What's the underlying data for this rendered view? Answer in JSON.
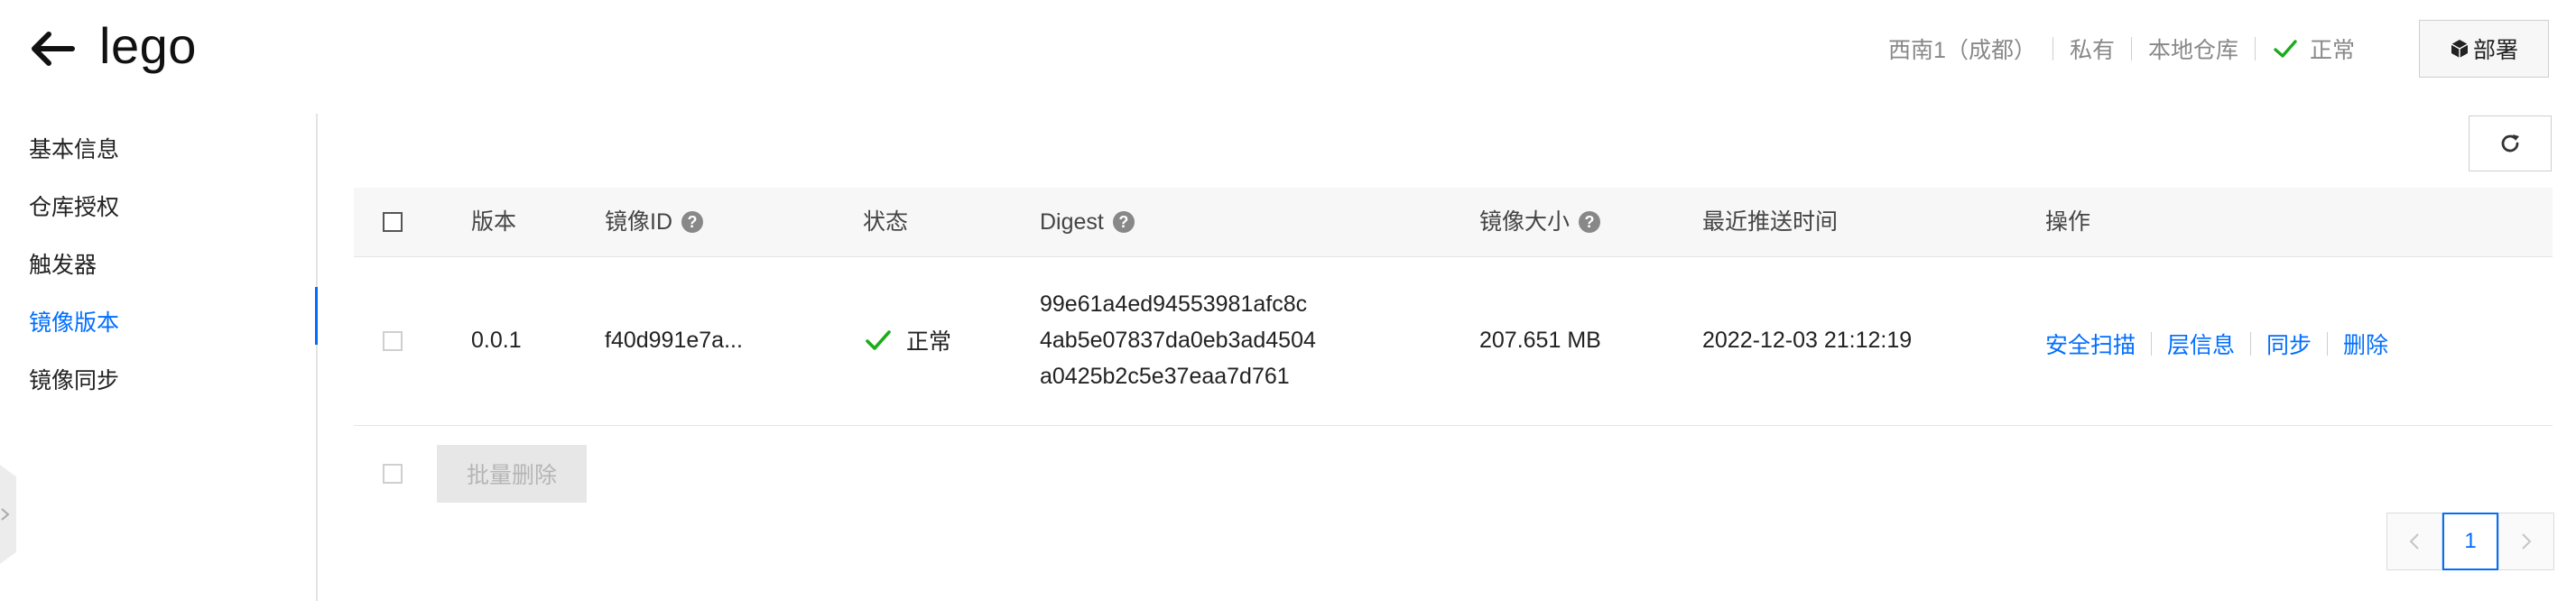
{
  "header": {
    "title": "lego",
    "region": "西南1（成都）",
    "visibility": "私有",
    "repo_type": "本地仓库",
    "status": "正常",
    "deploy_label": "部署"
  },
  "sidebar": {
    "items": [
      {
        "label": "基本信息"
      },
      {
        "label": "仓库授权"
      },
      {
        "label": "触发器"
      },
      {
        "label": "镜像版本",
        "active": true
      },
      {
        "label": "镜像同步"
      }
    ]
  },
  "table": {
    "columns": {
      "version": "版本",
      "image_id": "镜像ID",
      "status": "状态",
      "digest": "Digest",
      "size": "镜像大小",
      "pushed": "最近推送时间",
      "actions": "操作"
    },
    "rows": [
      {
        "version": "0.0.1",
        "image_id": "f40d991e7a...",
        "status": "正常",
        "digest_lines": [
          "99e61a4ed94553981afc8c",
          "4ab5e07837da0eb3ad4504",
          "a0425b2c5e37eaa7d761"
        ],
        "size": "207.651 MB",
        "pushed": "2022-12-03 21:12:19",
        "actions": {
          "scan": "安全扫描",
          "layers": "层信息",
          "sync": "同步",
          "delete": "删除"
        }
      }
    ]
  },
  "footer": {
    "batch_delete": "批量删除"
  },
  "pagination": {
    "current": "1"
  },
  "colors": {
    "accent": "#006eff",
    "success": "#1aad19"
  }
}
